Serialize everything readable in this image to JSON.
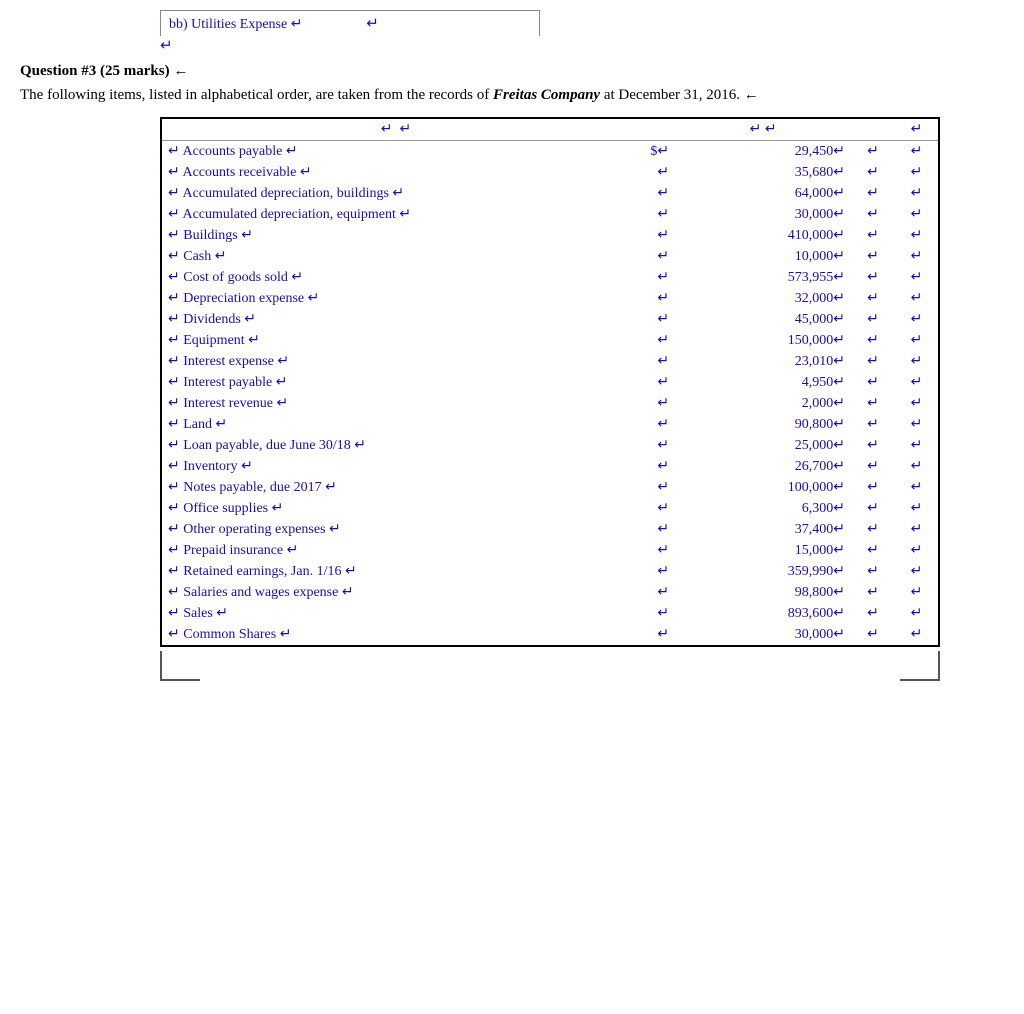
{
  "top": {
    "label": "bb) Utilities Expense ↵",
    "arrow": "↵"
  },
  "question": {
    "header": "Question #3  (25 marks) ←",
    "intro1": "The following items, listed in alphabetical order, are taken from the records of ",
    "company": "Freitas Company",
    "intro2": " at December 31, 2016. ←"
  },
  "table": {
    "header_arrows": [
      "↵",
      "↵",
      "↵",
      "↵",
      "↵",
      "↵"
    ],
    "rows": [
      {
        "label": "↵  Accounts payable ↵",
        "dollar": "$↵",
        "value": "29,450↵",
        "a1": "↵",
        "a2": "↵"
      },
      {
        "label": "↵  Accounts receivable ↵",
        "dollar": "",
        "value": "35,680↵",
        "a1": "↵",
        "a2": "↵"
      },
      {
        "label": "↵  Accumulated depreciation, buildings ↵",
        "dollar": "",
        "value": "64,000↵",
        "a1": "↵",
        "a2": "↵"
      },
      {
        "label": "↵  Accumulated depreciation, equipment ↵",
        "dollar": "",
        "value": "30,000↵",
        "a1": "↵",
        "a2": "↵"
      },
      {
        "label": "↵  Buildings ↵",
        "dollar": "",
        "value": "410,000↵",
        "a1": "↵",
        "a2": "↵"
      },
      {
        "label": "↵  Cash ↵",
        "dollar": "",
        "value": "10,000↵",
        "a1": "↵",
        "a2": "↵"
      },
      {
        "label": "↵  Cost of goods sold ↵",
        "dollar": "",
        "value": "573,955↵",
        "a1": "↵",
        "a2": "↵"
      },
      {
        "label": "↵  Depreciation expense ↵",
        "dollar": "",
        "value": "32,000↵",
        "a1": "↵",
        "a2": "↵"
      },
      {
        "label": "↵  Dividends ↵",
        "dollar": "",
        "value": "45,000↵",
        "a1": "↵",
        "a2": "↵"
      },
      {
        "label": "↵  Equipment ↵",
        "dollar": "",
        "value": "150,000↵",
        "a1": "↵",
        "a2": "↵"
      },
      {
        "label": "↵  Interest expense ↵",
        "dollar": "",
        "value": "23,010↵",
        "a1": "↵",
        "a2": "↵"
      },
      {
        "label": "↵  Interest payable ↵",
        "dollar": "",
        "value": "4,950↵",
        "a1": "↵",
        "a2": "↵"
      },
      {
        "label": "↵  Interest revenue ↵",
        "dollar": "",
        "value": "2,000↵",
        "a1": "↵",
        "a2": "↵"
      },
      {
        "label": "↵  Land ↵",
        "dollar": "",
        "value": "90,800↵",
        "a1": "↵",
        "a2": "↵"
      },
      {
        "label": "↵  Loan payable, due June 30/18 ↵",
        "dollar": "",
        "value": "25,000↵",
        "a1": "↵",
        "a2": "↵"
      },
      {
        "label": "↵  Inventory ↵",
        "dollar": "",
        "value": "26,700↵",
        "a1": "↵",
        "a2": "↵"
      },
      {
        "label": "↵  Notes payable, due 2017 ↵",
        "dollar": "",
        "value": "100,000↵",
        "a1": "↵",
        "a2": "↵"
      },
      {
        "label": "↵  Office supplies ↵",
        "dollar": "",
        "value": "6,300↵",
        "a1": "↵",
        "a2": "↵"
      },
      {
        "label": "↵  Other operating expenses ↵",
        "dollar": "",
        "value": "37,400↵",
        "a1": "↵",
        "a2": "↵"
      },
      {
        "label": "↵  Prepaid insurance ↵",
        "dollar": "",
        "value": "15,000↵",
        "a1": "↵",
        "a2": "↵"
      },
      {
        "label": "↵  Retained earnings, Jan. 1/16 ↵",
        "dollar": "",
        "value": "359,990↵",
        "a1": "↵",
        "a2": "↵"
      },
      {
        "label": "↵  Salaries and wages expense ↵",
        "dollar": "",
        "value": "98,800↵",
        "a1": "↵",
        "a2": "↵"
      },
      {
        "label": "↵  Sales ↵",
        "dollar": "",
        "value": "893,600↵",
        "a1": "↵",
        "a2": "↵"
      },
      {
        "label": "↵  Common Shares ↵",
        "dollar": "",
        "value": "30,000↵",
        "a1": "↵",
        "a2": "↵"
      }
    ]
  }
}
